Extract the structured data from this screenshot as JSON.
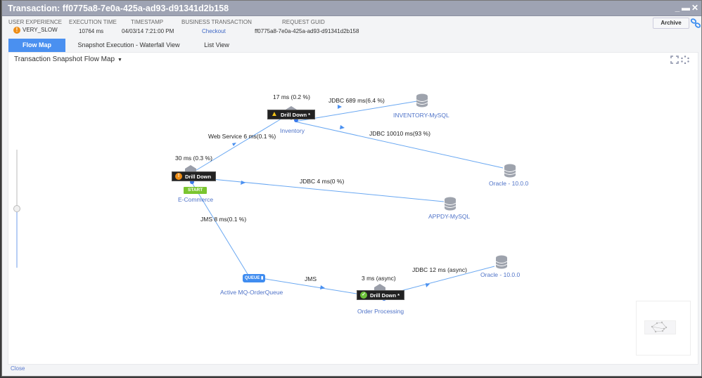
{
  "window": {
    "title": "Transaction: ff0775a8-7e0a-425a-ad93-d91341d2b158",
    "controls": [
      "minimize",
      "maximize",
      "close"
    ]
  },
  "summary": {
    "user_experience": {
      "label": "USER EXPERIENCE",
      "value": "VERY_SLOW",
      "icon": "warning-icon",
      "color": "#ee8e16"
    },
    "execution_time": {
      "label": "EXECUTION TIME",
      "value": "10764 ms"
    },
    "timestamp": {
      "label": "TIMESTAMP",
      "value": "04/03/14 7:21:00 PM"
    },
    "business_transaction": {
      "label": "BUSINESS TRANSACTION",
      "value": "Checkout"
    },
    "request_guid": {
      "label": "REQUEST GUID",
      "value": "ff0775a8-7e0a-425a-ad93-d91341d2b158"
    }
  },
  "toolbar": {
    "archive_label": "Archive",
    "link_icon": "link-icon"
  },
  "tabs": [
    {
      "label": "Flow Map",
      "active": true
    },
    {
      "label": "Snapshot Execution - Waterfall View",
      "active": false
    },
    {
      "label": "List View",
      "active": false
    }
  ],
  "panel": {
    "title": "Transaction Snapshot Flow Map",
    "tools": [
      "fit-to-screen-icon",
      "auto-layout-icon"
    ]
  },
  "flow_map": {
    "nodes": {
      "ecommerce": {
        "label": "E-Commerce",
        "time": "30 ms (0.3 %)",
        "drill": "Drill Down",
        "status": "error",
        "start_badge": "START"
      },
      "inventory": {
        "label": "Inventory",
        "time": "17 ms (0.2 %)",
        "drill": "Drill Down *",
        "status": "warning"
      },
      "order_processing": {
        "label": "Order Processing",
        "time": "3 ms (async)",
        "drill": "Drill Down *",
        "status": "normal"
      },
      "queue": {
        "label": "Active MQ-OrderQueue",
        "badge": "QUEUE"
      },
      "inventory_mysql": {
        "label": "INVENTORY-MySQL"
      },
      "oracle1": {
        "label": "Oracle - 10.0.0"
      },
      "appdy_mysql": {
        "label": "APPDY-MySQL"
      },
      "oracle2": {
        "label": "Oracle - 10.0.0"
      }
    },
    "edges": {
      "ecom_inventory": "Web Service  6 ms(0.1 %)",
      "inventory_mysql": "JDBC  689 ms(6.4 %)",
      "inventory_oracle": "JDBC  10010 ms(93 %)",
      "ecom_appdy": "JDBC  4 ms(0 %)",
      "ecom_queue": "JMS  8 ms(0.1 %)",
      "queue_order": "JMS",
      "order_oracle": "JDBC  12 ms (async)"
    },
    "zoom_level": 0.5
  },
  "footer": {
    "close_label": "Close"
  }
}
